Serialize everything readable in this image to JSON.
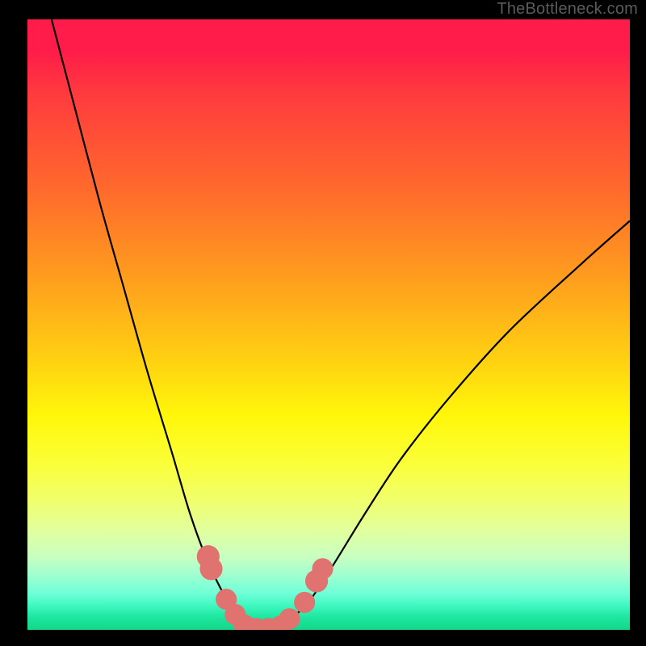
{
  "watermark": "TheBottleneck.com",
  "chart_data": {
    "type": "line",
    "title": "",
    "xlabel": "",
    "ylabel": "",
    "xlim": [
      0,
      100
    ],
    "ylim": [
      0,
      100
    ],
    "grid": false,
    "gradient_stops": [
      {
        "pos": 0,
        "color": "#ff1b4a"
      },
      {
        "pos": 5,
        "color": "#ff1b4a"
      },
      {
        "pos": 12,
        "color": "#ff3a3e"
      },
      {
        "pos": 28,
        "color": "#ff6a2c"
      },
      {
        "pos": 42,
        "color": "#ff9c1e"
      },
      {
        "pos": 55,
        "color": "#ffce12"
      },
      {
        "pos": 65,
        "color": "#fff70a"
      },
      {
        "pos": 73,
        "color": "#faff3a"
      },
      {
        "pos": 79,
        "color": "#f0ff6e"
      },
      {
        "pos": 84,
        "color": "#e0ffa0"
      },
      {
        "pos": 88,
        "color": "#c8ffc0"
      },
      {
        "pos": 91,
        "color": "#a0ffd0"
      },
      {
        "pos": 94,
        "color": "#70ffd8"
      },
      {
        "pos": 96,
        "color": "#40f8c0"
      },
      {
        "pos": 98,
        "color": "#1ce69f"
      },
      {
        "pos": 100,
        "color": "#15d788"
      }
    ],
    "series": [
      {
        "name": "bottleneck-curve",
        "color": "#000000",
        "x": [
          4,
          8,
          12,
          16,
          20,
          24,
          27,
          30,
          33,
          34.5,
          36,
          38,
          40,
          42,
          44,
          47,
          51,
          56,
          62,
          70,
          80,
          92,
          100
        ],
        "y": [
          100,
          85,
          70,
          56,
          42,
          29,
          19,
          11,
          5,
          2,
          0.5,
          0,
          0,
          0.5,
          2,
          5,
          11,
          19,
          28,
          38,
          49,
          60,
          67
        ]
      }
    ],
    "markers": {
      "name": "highlight-points",
      "color": "#e0736f",
      "points": [
        {
          "x": 30.0,
          "y": 12.0,
          "r": 1.4
        },
        {
          "x": 30.5,
          "y": 10.0,
          "r": 1.4
        },
        {
          "x": 33.0,
          "y": 5.0,
          "r": 1.3
        },
        {
          "x": 34.5,
          "y": 2.5,
          "r": 1.3
        },
        {
          "x": 36.0,
          "y": 0.8,
          "r": 1.3
        },
        {
          "x": 38.0,
          "y": 0.2,
          "r": 1.3
        },
        {
          "x": 40.0,
          "y": 0.2,
          "r": 1.3
        },
        {
          "x": 42.0,
          "y": 0.6,
          "r": 1.3
        },
        {
          "x": 43.5,
          "y": 1.8,
          "r": 1.3
        },
        {
          "x": 46.0,
          "y": 4.5,
          "r": 1.3
        },
        {
          "x": 48.0,
          "y": 8.0,
          "r": 1.4
        },
        {
          "x": 49.0,
          "y": 10.0,
          "r": 1.3
        }
      ]
    }
  }
}
